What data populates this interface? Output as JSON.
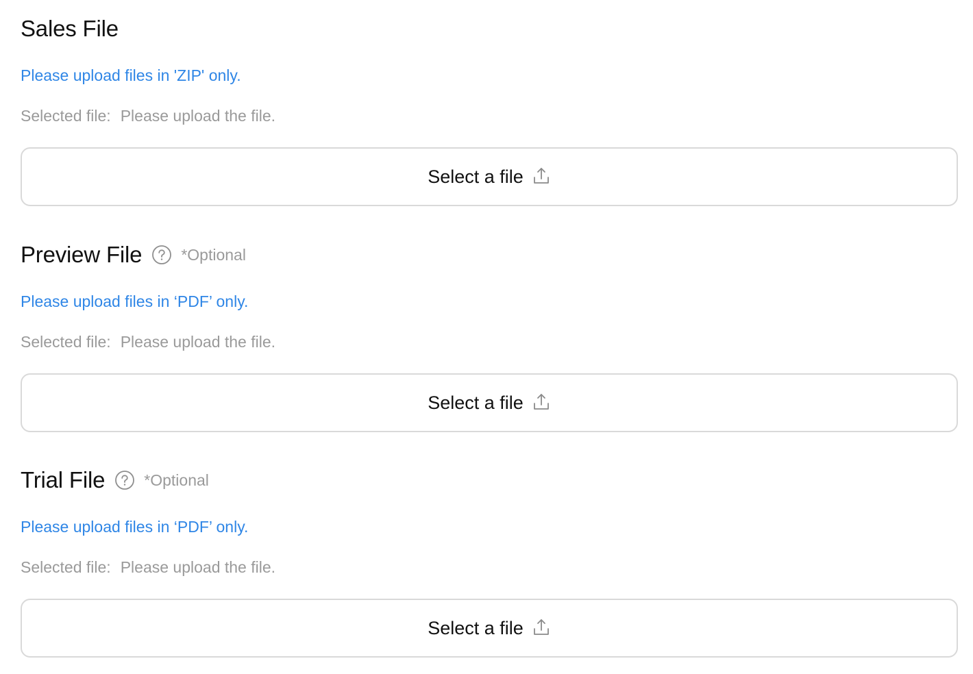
{
  "sections": [
    {
      "title": "Sales File",
      "optional": "",
      "hint": "Please upload files in 'ZIP' only.",
      "selected_label": "Selected file:",
      "selected_value": "Please upload the file.",
      "button_label": "Select a file",
      "icons": {
        "button": "upload-icon"
      }
    },
    {
      "title": "Preview File",
      "optional": "*Optional",
      "hint": "Please upload files in ‘PDF’ only.",
      "selected_label": "Selected file:",
      "selected_value": "Please upload the file.",
      "button_label": "Select a file",
      "icons": {
        "help": "question-circle-icon",
        "button": "upload-icon"
      }
    },
    {
      "title": "Trial File",
      "optional": "*Optional",
      "hint": "Please upload files in ‘PDF’ only.",
      "selected_label": "Selected file:",
      "selected_value": "Please upload the file.",
      "button_label": "Select a file",
      "icons": {
        "help": "question-circle-icon",
        "button": "upload-icon"
      }
    }
  ],
  "colors": {
    "hint": "#2f86e6",
    "muted": "#9a9a9a",
    "border": "#d9d9d9",
    "text": "#111111"
  }
}
